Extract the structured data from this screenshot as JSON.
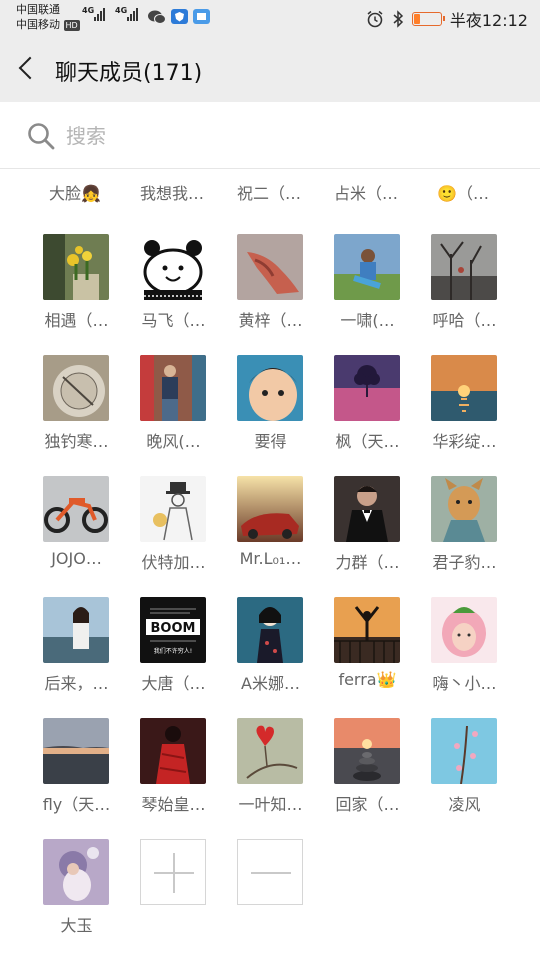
{
  "status_bar": {
    "carrier1": "中国联通",
    "carrier2": "中国移动",
    "hd_badge": "HD",
    "net1": "4G",
    "net2": "4G",
    "time": "半夜12:12",
    "battery_level": 0.25,
    "icons": [
      "signal-icon",
      "wechat-icon",
      "shield-app-icon",
      "app-icon",
      "alarm-icon",
      "bluetooth-icon",
      "battery-icon"
    ]
  },
  "header": {
    "back_icon": "back-arrow-icon",
    "title": "聊天成员(171)"
  },
  "search": {
    "placeholder": "搜索",
    "value": ""
  },
  "partial_row": [
    "大脸👧",
    "我想我…",
    "祝二（…",
    "占米（…",
    "🙂（…"
  ],
  "members": [
    {
      "name": "相遇（…"
    },
    {
      "name": "马飞（…"
    },
    {
      "name": "黄梓（…"
    },
    {
      "name": "一啸(…"
    },
    {
      "name": "呼哈（…"
    },
    {
      "name": "独钓寒…"
    },
    {
      "name": "晚风(…"
    },
    {
      "name": "要得"
    },
    {
      "name": "枫（天…"
    },
    {
      "name": "华彩绽…"
    },
    {
      "name": "JOJO…"
    },
    {
      "name": "伏特加…"
    },
    {
      "name": "Mr.L₀₁…"
    },
    {
      "name": "力群（…"
    },
    {
      "name": "君子豹…"
    },
    {
      "name": "后来，…"
    },
    {
      "name": "大唐（…"
    },
    {
      "name": "A米娜…"
    },
    {
      "name": "ferra👑"
    },
    {
      "name": "嗨丶小…"
    },
    {
      "name": "fly（天…"
    },
    {
      "name": "琴始皇…"
    },
    {
      "name": "一叶知…"
    },
    {
      "name": "回家（…"
    },
    {
      "name": "凌风"
    },
    {
      "name": "大玉"
    }
  ],
  "avatar_text": {
    "boom_line1": "BOOM",
    "boom_line2": "我们不许穷人!"
  },
  "actions": {
    "add_icon": "plus-icon",
    "remove_icon": "minus-icon"
  }
}
